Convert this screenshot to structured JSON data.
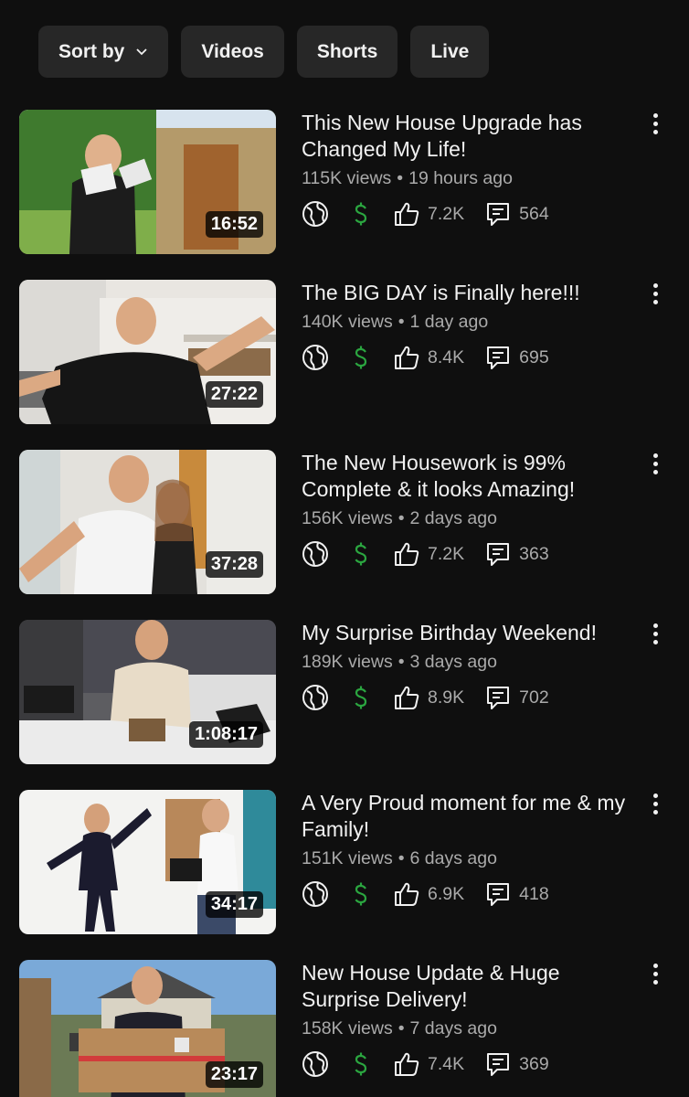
{
  "filters": {
    "sort_label": "Sort by",
    "videos_label": "Videos",
    "shorts_label": "Shorts",
    "live_label": "Live"
  },
  "icons": {
    "visibility": "globe-icon",
    "monetization": "dollar-icon",
    "likes": "thumbs-up-icon",
    "comments": "comment-icon",
    "menu": "more-vert-icon"
  },
  "colors": {
    "background": "#0f0f0f",
    "chip": "#272727",
    "monetized": "#2ba640",
    "secondary_text": "#aaaaaa"
  },
  "videos": [
    {
      "title": "This New House Upgrade has Changed My Life!",
      "views": "115K views",
      "age": "19 hours ago",
      "duration": "16:52",
      "likes": "7.2K",
      "comments": "564"
    },
    {
      "title": "The BIG DAY is Finally here!!!",
      "views": "140K views",
      "age": "1 day ago",
      "duration": "27:22",
      "likes": "8.4K",
      "comments": "695"
    },
    {
      "title": "The New Housework is 99% Complete & it looks Amazing!",
      "views": "156K views",
      "age": "2 days ago",
      "duration": "37:28",
      "likes": "7.2K",
      "comments": "363"
    },
    {
      "title": "My Surprise Birthday Weekend!",
      "views": "189K views",
      "age": "3 days ago",
      "duration": "1:08:17",
      "likes": "8.9K",
      "comments": "702"
    },
    {
      "title": "A Very Proud moment for me & my Family!",
      "views": "151K views",
      "age": "6 days ago",
      "duration": "34:17",
      "likes": "6.9K",
      "comments": "418"
    },
    {
      "title": "New House Update & Huge Surprise Delivery!",
      "views": "158K views",
      "age": "7 days ago",
      "duration": "23:17",
      "likes": "7.4K",
      "comments": "369"
    }
  ]
}
